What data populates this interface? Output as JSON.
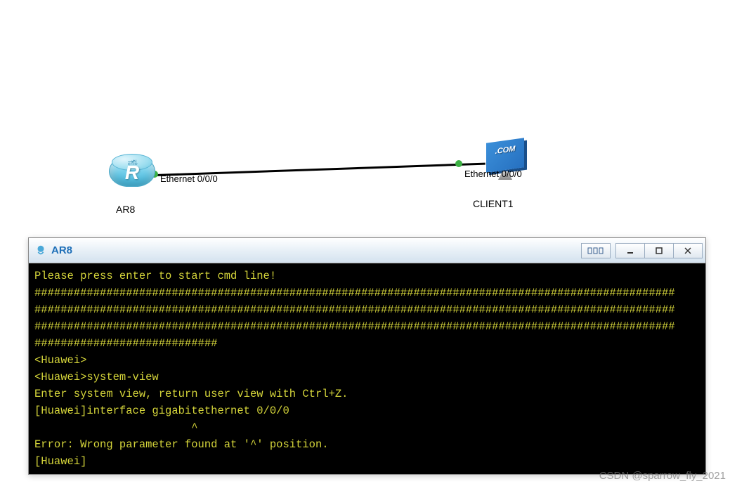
{
  "topology": {
    "router": {
      "letter": "R",
      "label": "AR8",
      "port_label": "Ethernet 0/0/0"
    },
    "client": {
      "box_text": ".COM",
      "label": "CLIENT1",
      "port_label": "Ethernet 0/0/0"
    }
  },
  "terminal": {
    "title": "AR8",
    "lines": {
      "l1": "Please press enter to start cmd line!",
      "l2": "##################################################################################################",
      "l3": "##################################################################################################",
      "l4": "##################################################################################################",
      "l5": "############################",
      "l6": "<Huawei>",
      "l7": "<Huawei>system-view",
      "l8": "Enter system view, return user view with Ctrl+Z.",
      "l9": "[Huawei]interface gigabitethernet 0/0/0",
      "l10": "                        ^",
      "l11": "Error: Wrong parameter found at '^' position.",
      "l12": "[Huawei]"
    }
  },
  "watermark": "CSDN @sparrow_fly_2021"
}
